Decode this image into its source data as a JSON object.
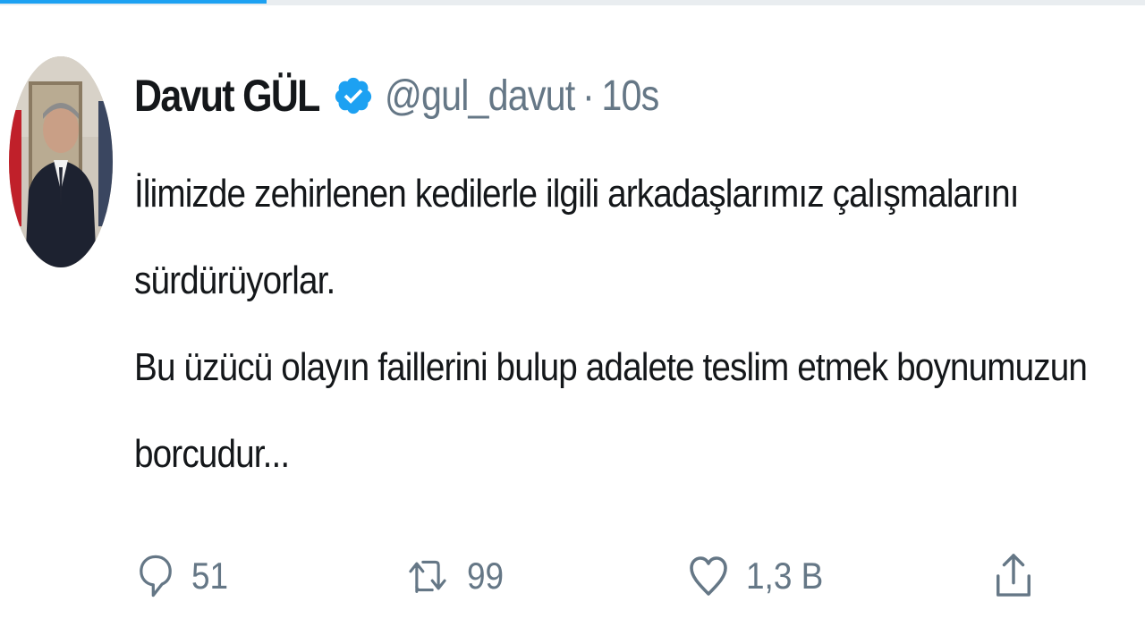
{
  "tweet": {
    "author": {
      "display_name": "Davut GÜL",
      "handle": "@gul_davut",
      "verified": true,
      "avatar": "avatar-portrait"
    },
    "separator": "·",
    "time": "10s",
    "text_lines": [
      "İlimizde zehirlenen kedilerle ilgili arkadaşlarımız çalışmalarını",
      "sürdürüyorlar.",
      "Bu üzücü olayın faillerini bulup adalete teslim etmek boynumuzun",
      "borcudur..."
    ],
    "actions": {
      "reply": {
        "icon": "reply-icon",
        "count": "51"
      },
      "retweet": {
        "icon": "retweet-icon",
        "count": "99"
      },
      "like": {
        "icon": "heart-icon",
        "count": "1,3 B"
      },
      "share": {
        "icon": "share-icon"
      }
    }
  },
  "colors": {
    "accent": "#1da1f2",
    "text": "#14171a",
    "muted": "#657786"
  }
}
